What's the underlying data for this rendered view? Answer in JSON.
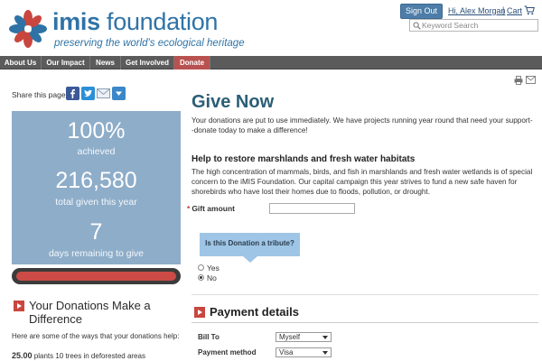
{
  "header": {
    "brand_strong": "imis",
    "brand_rest": " foundation",
    "tagline": "preserving the world's ecological heritage",
    "signout_label": "Sign Out",
    "greeting": "Hi, Alex Morgan",
    "separator": "|",
    "cart_label": "Cart",
    "search_placeholder": "Keyword Search"
  },
  "nav": {
    "items": [
      "About Us",
      "Our Impact",
      "News",
      "Get Involved",
      "Donate"
    ]
  },
  "share": {
    "label": "Share this page"
  },
  "stats": {
    "achieved_value": "100%",
    "achieved_label": "achieved",
    "given_value": "216,580",
    "given_label": "total given this year",
    "days_value": "7",
    "days_label": "days remaining to give",
    "progress_fraction": 1.0
  },
  "donations": {
    "title": "Your Donations Make a Difference",
    "desc": "Here are some of the ways that your donations help:",
    "row_amount": "25.00",
    "row_text": "plants 10 trees in deforested areas"
  },
  "main": {
    "title": "Give Now",
    "intro": "Your donations are put to use immediately. We have projects running year round that need your support--donate today to make a difference!",
    "help_title": "Help to restore marshlands and fresh water habitats",
    "help_desc": "The high concentration of mammals, birds, and fish in marshlands and fresh water wetlands is of special concern to the iMIS Foundation. Our capital campaign this year strives to fund a new safe haven for shorebirds who have lost their homes due to floods, pollution, or drought.",
    "required_mark": "*",
    "gift_label": "Gift amount",
    "tribute_question": "Is this Donation a tribute?",
    "tribute_options": [
      "Yes",
      "No"
    ],
    "tribute_selected": "No"
  },
  "payment": {
    "title": "Payment details",
    "bill_to_label": "Bill To",
    "bill_to_value": "Myself",
    "method_label": "Payment method",
    "method_value": "Visa"
  },
  "colors": {
    "brand_blue": "#2f73a6",
    "nav_bg": "#5b5b5b",
    "donate_red": "#b85250",
    "stats_bg": "#8eadc9",
    "progress_red": "#cc4b46",
    "title_teal": "#2b5e75",
    "tribute_blue": "#9ec5e5"
  },
  "icons": [
    "flower-logo-icon",
    "cart-icon",
    "search-icon",
    "facebook-icon",
    "twitter-icon",
    "email-icon",
    "share-dropdown-icon",
    "print-icon",
    "mail-icon",
    "section-arrow-icon"
  ]
}
